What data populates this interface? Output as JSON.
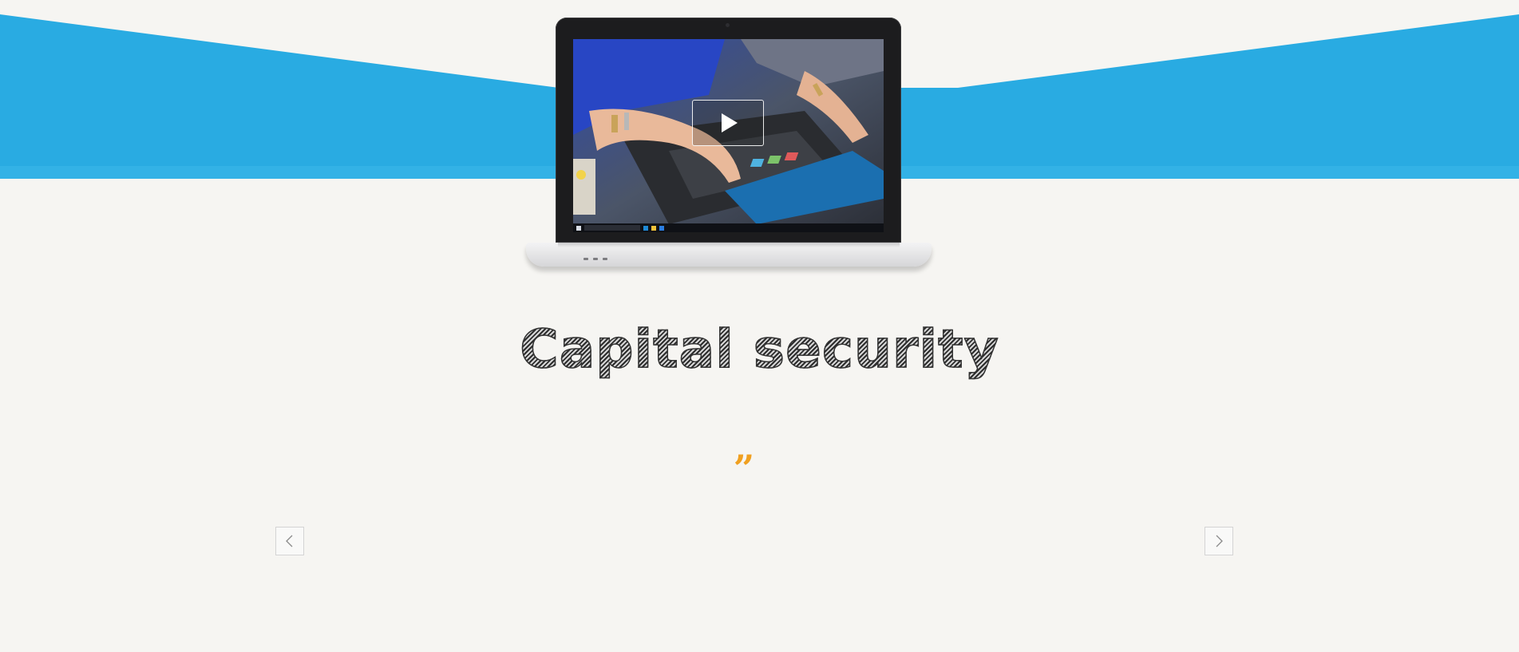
{
  "colors": {
    "band": "#29abe2",
    "background": "#f6f5f2",
    "quote_accent": "#f0a020"
  },
  "hero": {
    "video": {
      "play_icon": "play-icon"
    }
  },
  "headline": {
    "text": "Capital security"
  },
  "testimonial": {
    "quote_glyph": "”"
  },
  "carousel": {
    "prev_icon": "chevron-left-icon",
    "next_icon": "chevron-right-icon"
  }
}
